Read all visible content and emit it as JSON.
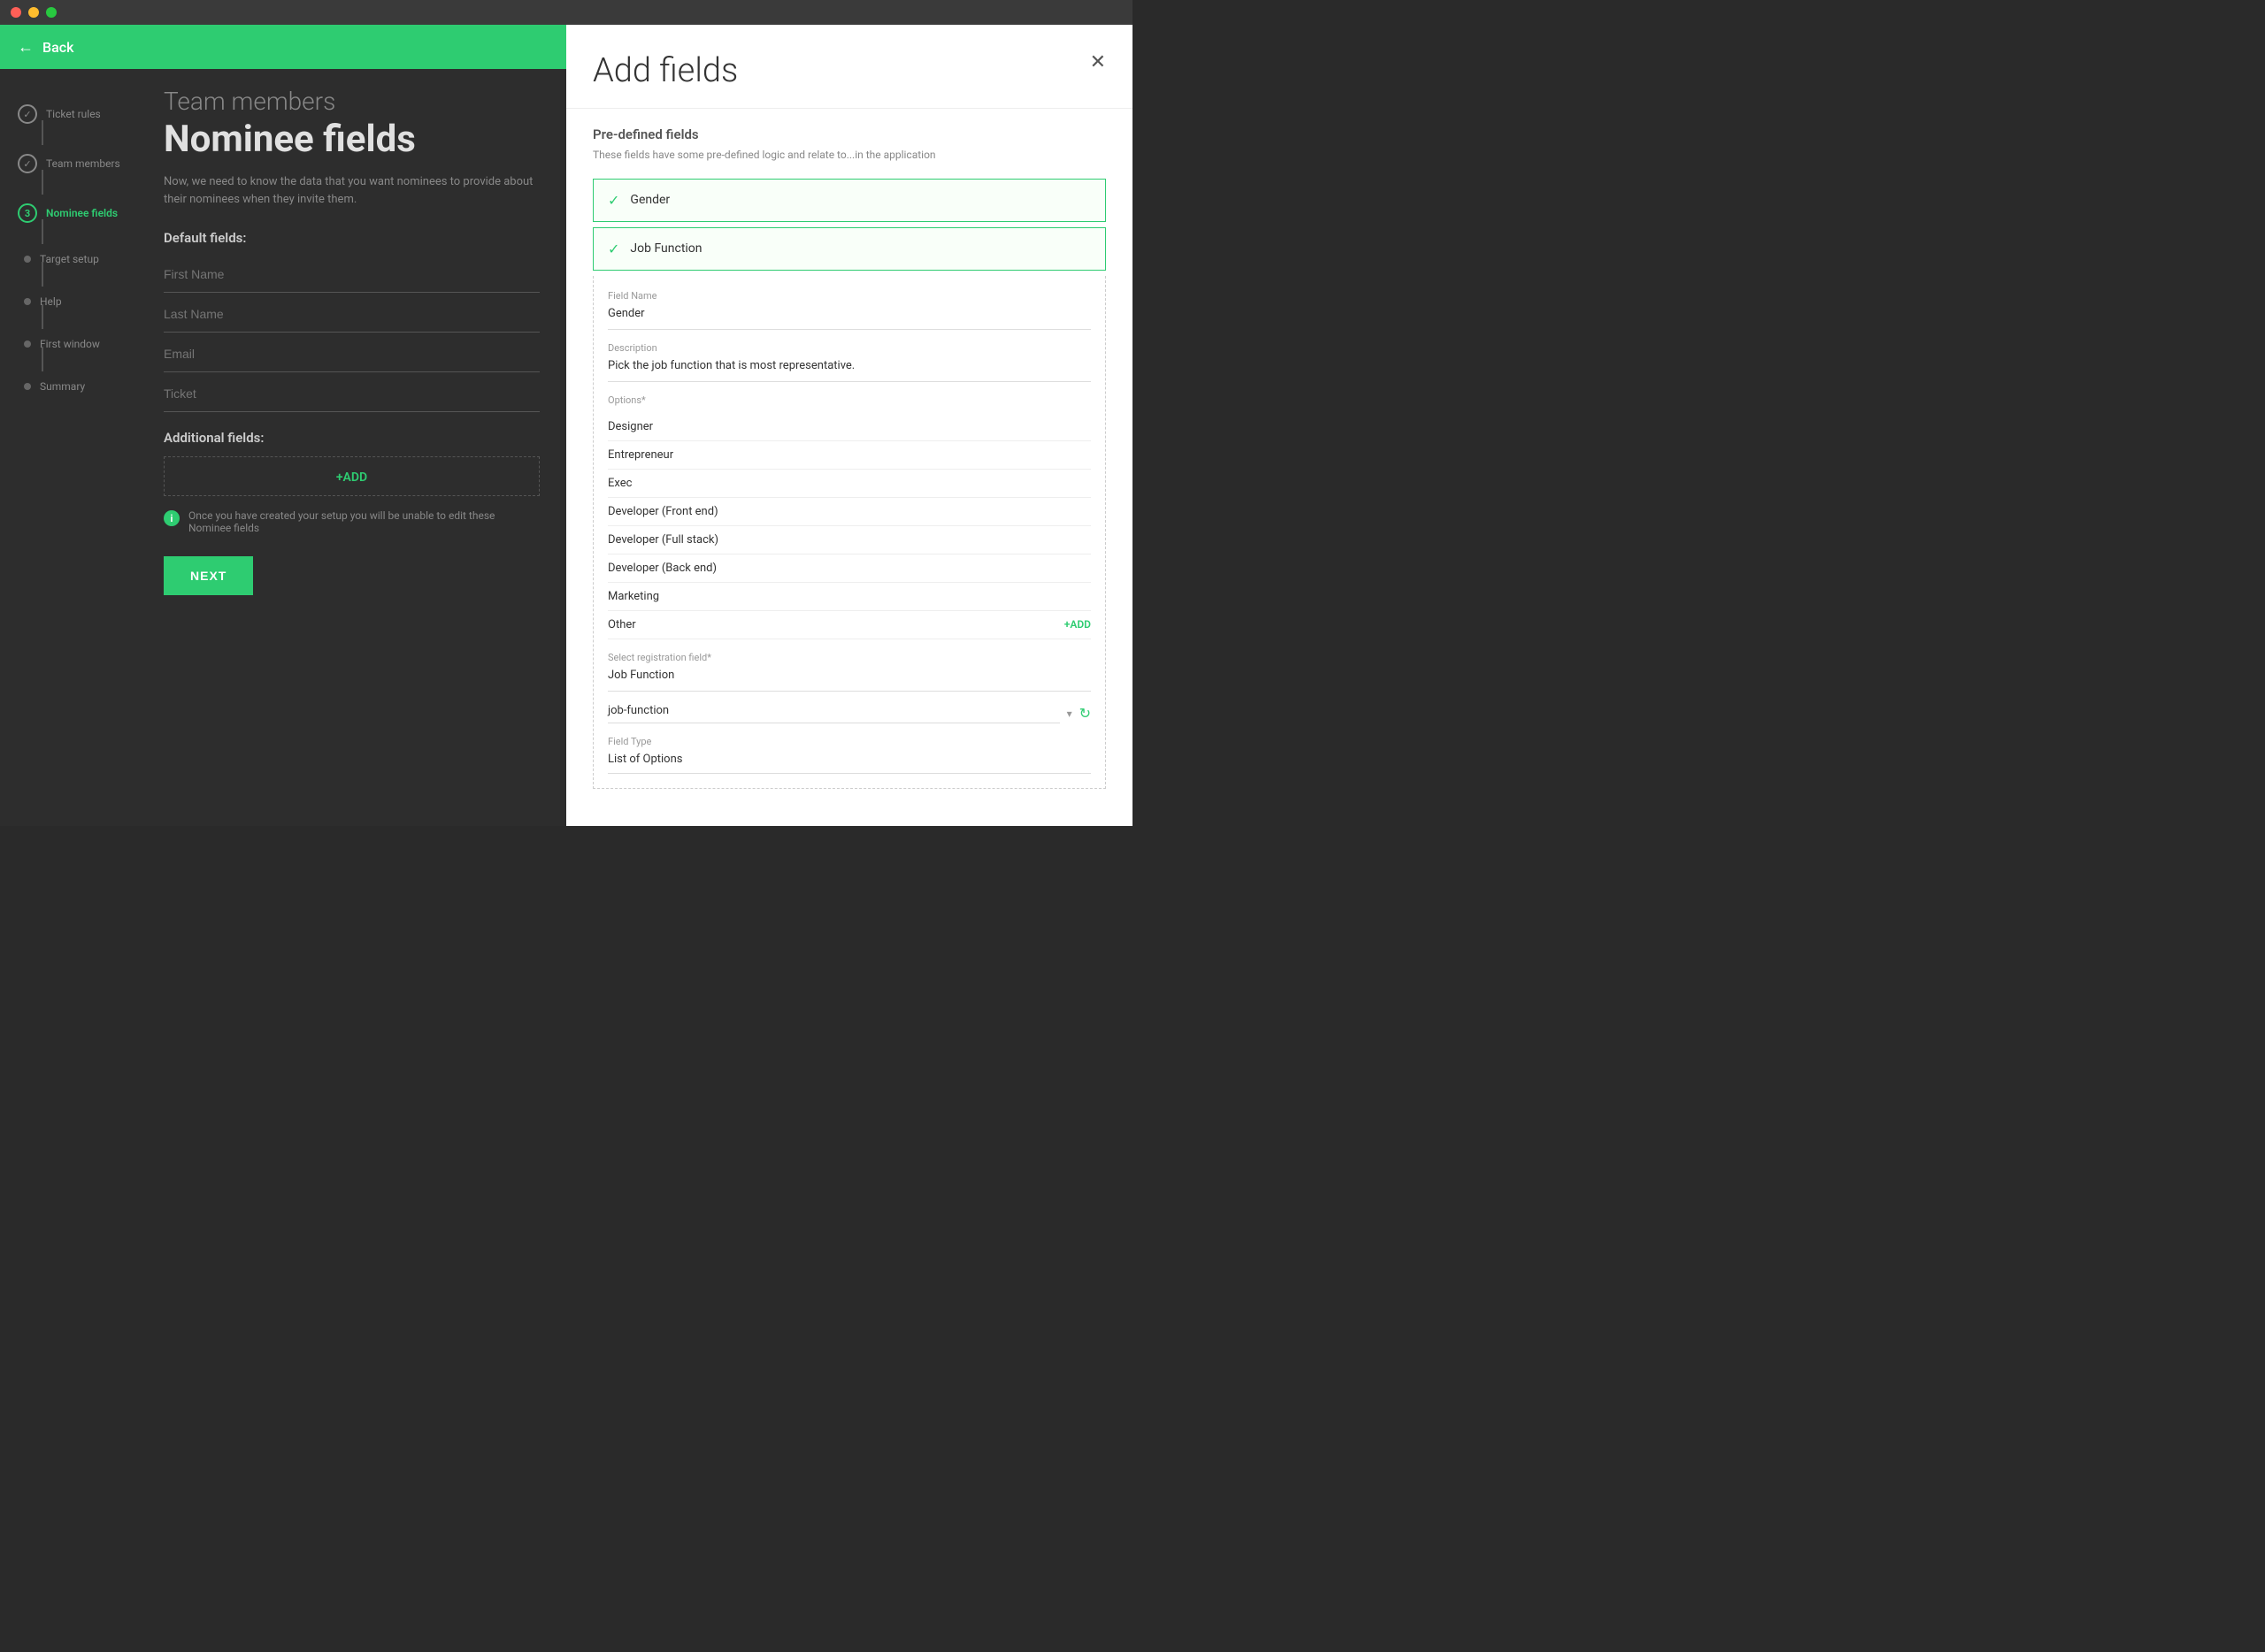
{
  "titleBar": {
    "lights": [
      "red",
      "yellow",
      "green"
    ]
  },
  "header": {
    "backLabel": "Back",
    "backArrow": "←"
  },
  "sidebar": {
    "items": [
      {
        "id": "ticket-rules",
        "label": "Ticket rules",
        "type": "check",
        "active": false
      },
      {
        "id": "team-members",
        "label": "Team members",
        "type": "check",
        "active": false
      },
      {
        "id": "nominee-fields",
        "label": "Nominee fields",
        "type": "number",
        "number": "3",
        "active": true
      },
      {
        "id": "target-setup",
        "label": "Target setup",
        "type": "dot",
        "active": false
      },
      {
        "id": "help",
        "label": "Help",
        "type": "dot",
        "active": false
      },
      {
        "id": "first-window",
        "label": "First window",
        "type": "dot",
        "active": false
      },
      {
        "id": "summary",
        "label": "Summary",
        "type": "dot",
        "active": false
      }
    ]
  },
  "main": {
    "teamMembersTitle": "Team members",
    "nomineeFieldsTitle": "Nominee fields",
    "description": "Now, we need to know the data that you want nominees to provide about their nominees when they invite them.",
    "defaultFieldsLabel": "Default fields:",
    "defaultFields": [
      {
        "placeholder": "First Name"
      },
      {
        "placeholder": "Last Name"
      },
      {
        "placeholder": "Email"
      },
      {
        "placeholder": "Ticket"
      }
    ],
    "additionalFieldsLabel": "Additional fields:",
    "addButtonLabel": "+ADD",
    "infoNote": "Once you have created your setup you will be unable to edit these Nominee fields",
    "nextButtonLabel": "NEXT"
  },
  "rightPanel": {
    "title": "Add fields",
    "closeIcon": "✕",
    "predefinedLabel": "Pre-defined fields",
    "predefinedDesc": "These fields have some pre-defined logic and relate to...in the application",
    "fields": [
      {
        "id": "gender",
        "label": "Gender",
        "selected": true
      },
      {
        "id": "job-function",
        "label": "Job Function",
        "selected": true
      }
    ],
    "fieldDetails": {
      "fieldNameLabel": "Field Name",
      "fieldNameValue": "Gender",
      "descriptionLabel": "Description",
      "descriptionValue": "Pick the job function that is most representative.",
      "optionsLabel": "Options*",
      "options": [
        "Designer",
        "Entrepreneur",
        "Exec",
        "Developer (Front end)",
        "Developer (Full stack)",
        "Developer (Back end)",
        "Marketing",
        "Other"
      ],
      "optionAddLabel": "+ADD",
      "selectRegFieldLabel": "Select registration field*",
      "selectRegFieldTitle": "Job Function",
      "selectRegFieldValue": "job-function",
      "chevronIcon": "▾",
      "refreshIcon": "↻",
      "fieldTypeLabel": "Field Type",
      "fieldTypeValue": "List of Options"
    }
  }
}
